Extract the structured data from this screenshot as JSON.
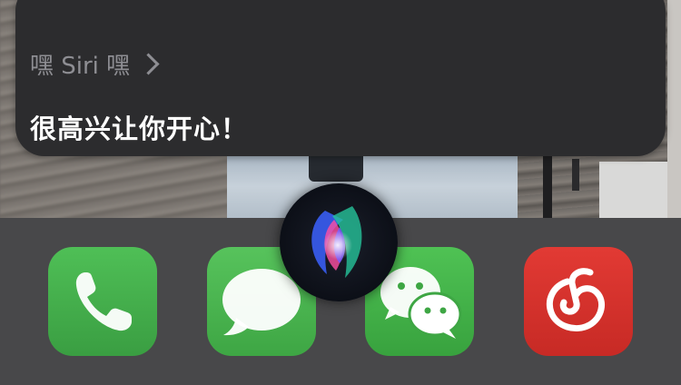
{
  "siri": {
    "query": "嘿 Siri 嘿",
    "response": "很高兴让你开心！"
  },
  "dock": {
    "apps": [
      {
        "name": "Phone",
        "icon": "phone-icon",
        "color": "#4cb852"
      },
      {
        "name": "Messages",
        "icon": "speech-bubble-icon",
        "color": "#4cb852"
      },
      {
        "name": "WeChat",
        "icon": "wechat-icon",
        "color": "#4cb852"
      },
      {
        "name": "NetEase Cloud Music",
        "icon": "netease-music-icon",
        "color": "#d4312c"
      }
    ]
  },
  "siri_orb": {
    "icon": "siri-orb-icon"
  }
}
